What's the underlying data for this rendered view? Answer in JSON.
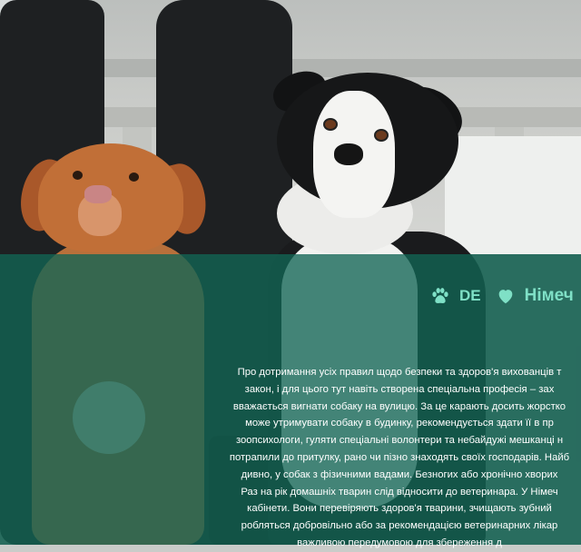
{
  "nav": {
    "lang_label": "DE",
    "country_label": "Німеч",
    "icons": [
      "paw-icon",
      "heart-icon"
    ],
    "accent_color": "#7fe0c6"
  },
  "overlay": {
    "color": "#126554"
  },
  "article": {
    "lines": [
      "Про дотримання усіх правил щодо безпеки та здоров'я вихованців т",
      "закон, і для цього тут навіть створена спеціальна професія – зах",
      "вважається вигнати собаку на вулицю. За це карають досить жорстко",
      "може утримувати собаку в будинку, рекомендується здати її в пр",
      "зоопсихологи, гуляти спеціальні волонтери та небайдужі мешканці н",
      "потрапили до притулку, рано чи пізно знаходять своїх господарів. Найб",
      "дивно, у собак з фізичними вадами. Безногих або хронічно хворих",
      "Раз на рік домашніх тварин слід відносити до ветеринара. У Німеч",
      "кабінети. Вони перевіряють здоров'я тварини, зчищають зубний",
      "робляться добровільно або за рекомендацією ветеринарних лікар",
      "важливою передумовою для збереження д"
    ]
  }
}
